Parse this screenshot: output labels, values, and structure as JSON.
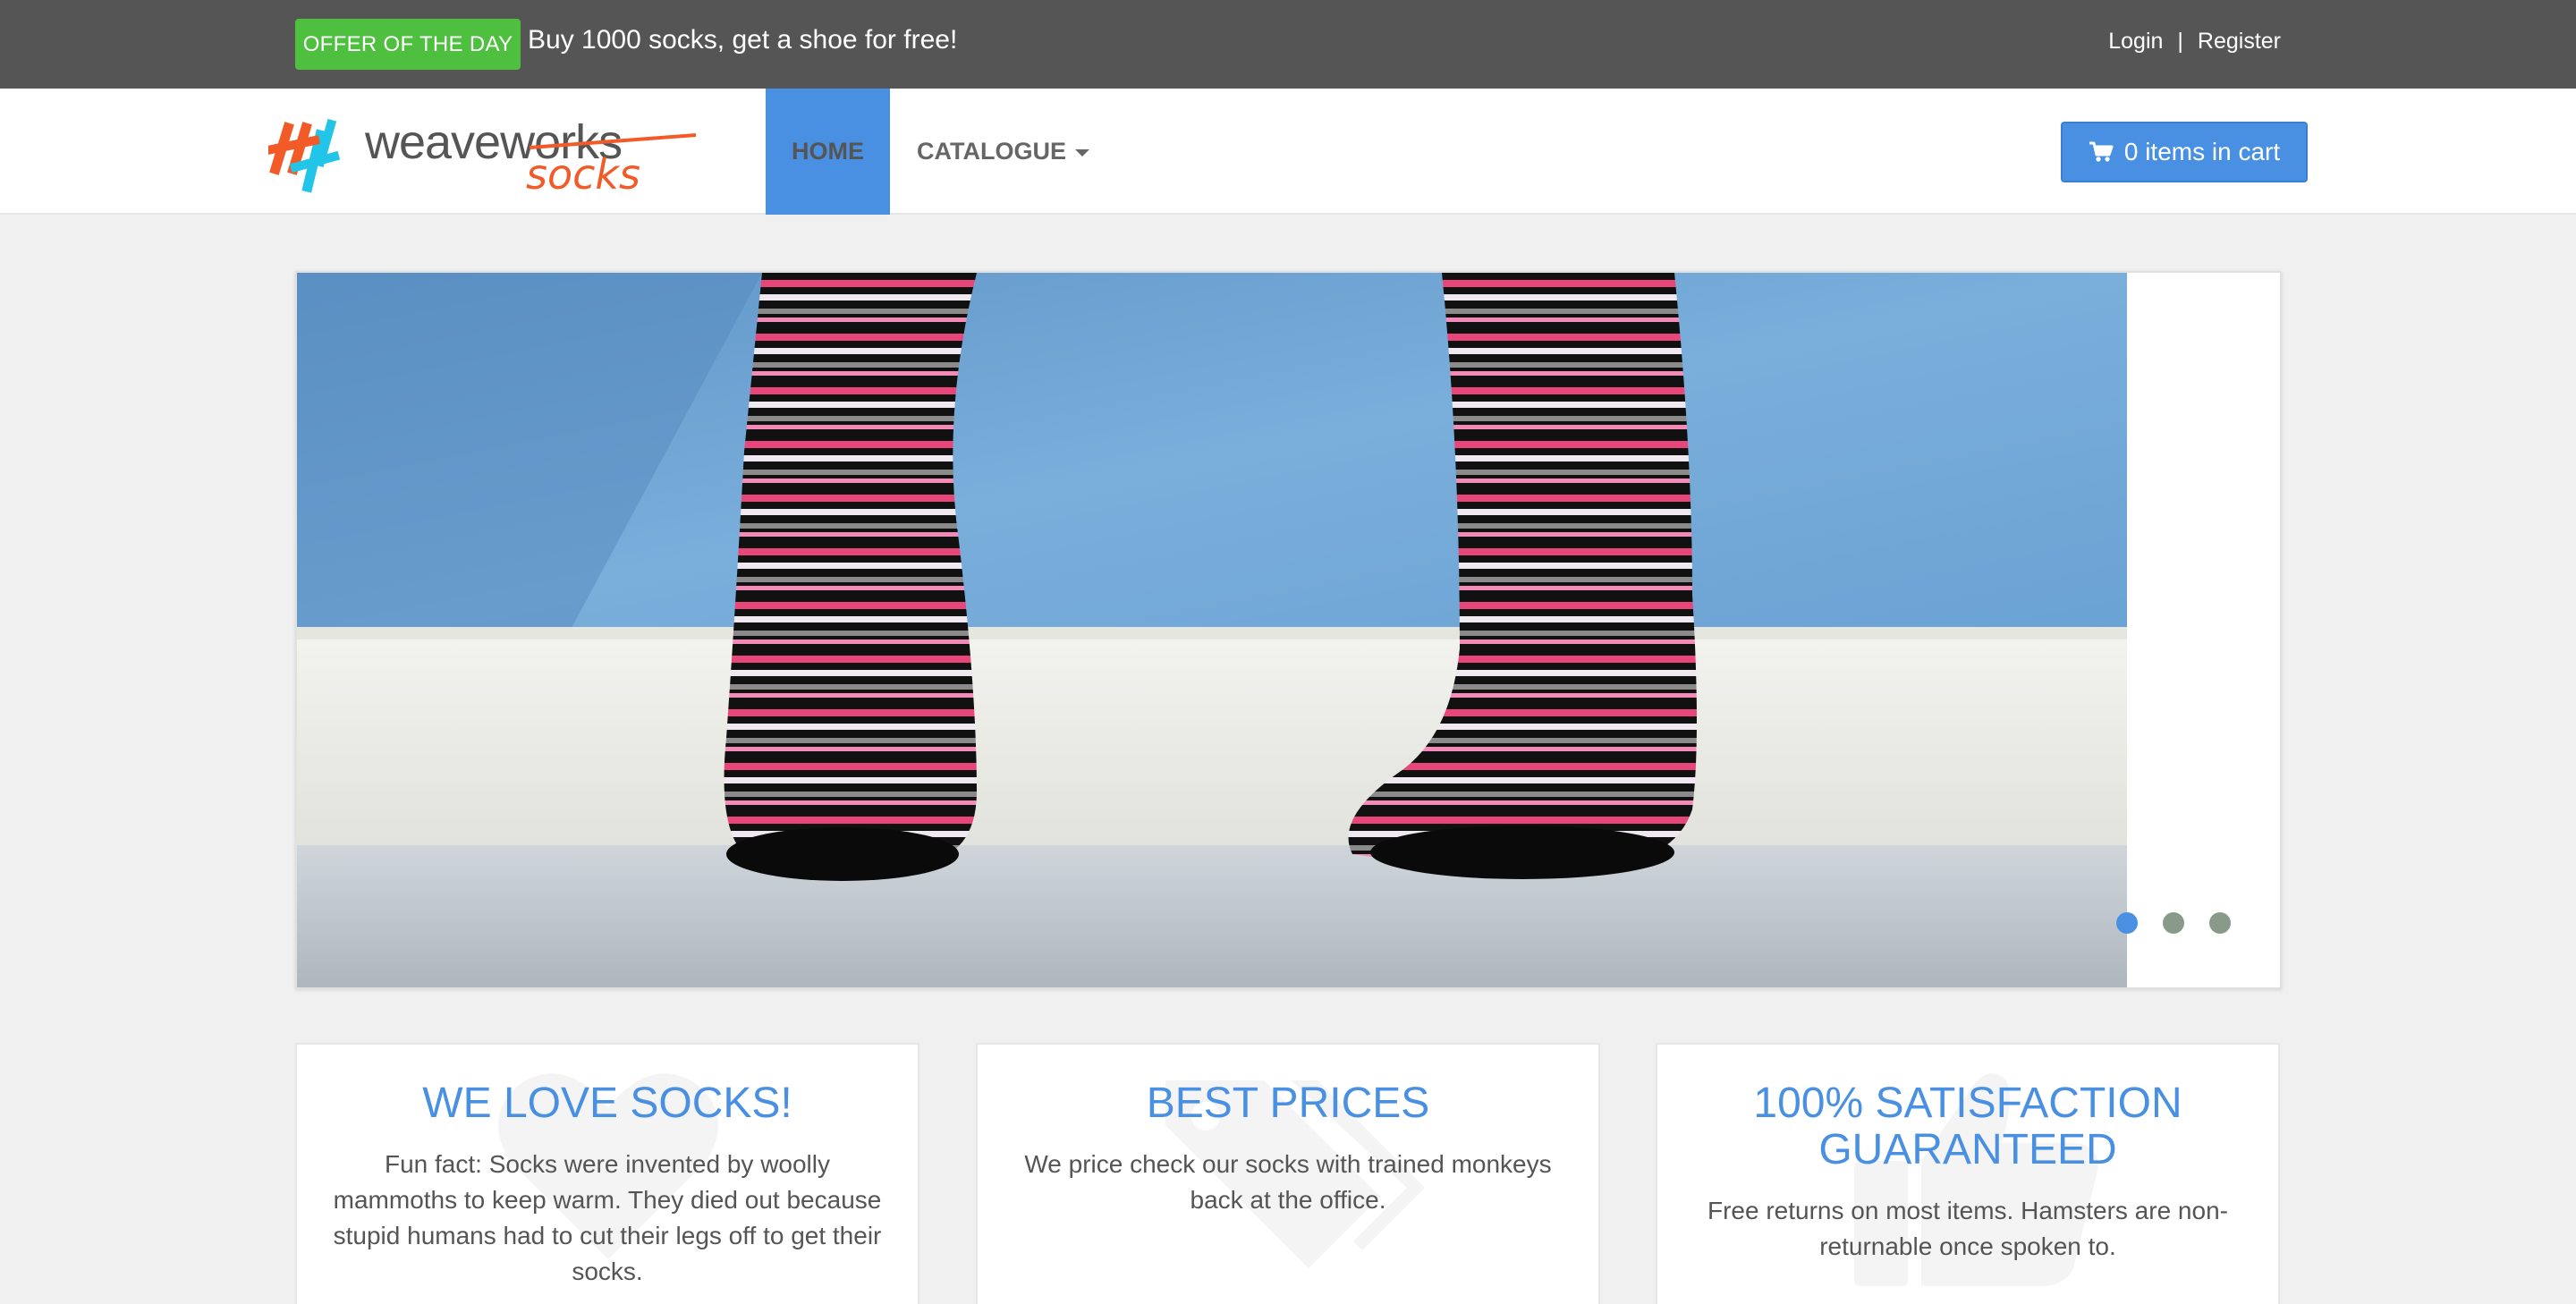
{
  "topbar": {
    "offer_badge": "OFFER OF THE DAY",
    "offer_text": "Buy 1000 socks, get a shoe for free!",
    "login": "Login",
    "separator": "|",
    "register": "Register"
  },
  "logo": {
    "brand": "weaveworks",
    "sub": "socks"
  },
  "nav": {
    "home": "HOME",
    "catalogue": "CATALOGUE"
  },
  "cart": {
    "label": "0 items in cart",
    "icon": "shopping-cart-icon"
  },
  "carousel": {
    "slide_count": 3,
    "active_index": 0
  },
  "features": [
    {
      "title": "WE LOVE SOCKS!",
      "text": "Fun fact: Socks were invented by woolly mammoths to keep warm. They died out because stupid humans had to cut their legs off to get their socks.",
      "icon": "heart-icon"
    },
    {
      "title": "BEST PRICES",
      "text": "We price check our socks with trained monkeys back at the office.",
      "icon": "tags-icon"
    },
    {
      "title": "100% SATISFACTION GUARANTEED",
      "text": "Free returns on most items. Hamsters are non-returnable once spoken to.",
      "icon": "thumbs-up-icon"
    }
  ],
  "colors": {
    "accent": "#4a90e2",
    "topbar": "#555555",
    "offer": "#4fbf40",
    "logo_orange": "#f25a28",
    "logo_cyan": "#22c4e8"
  }
}
